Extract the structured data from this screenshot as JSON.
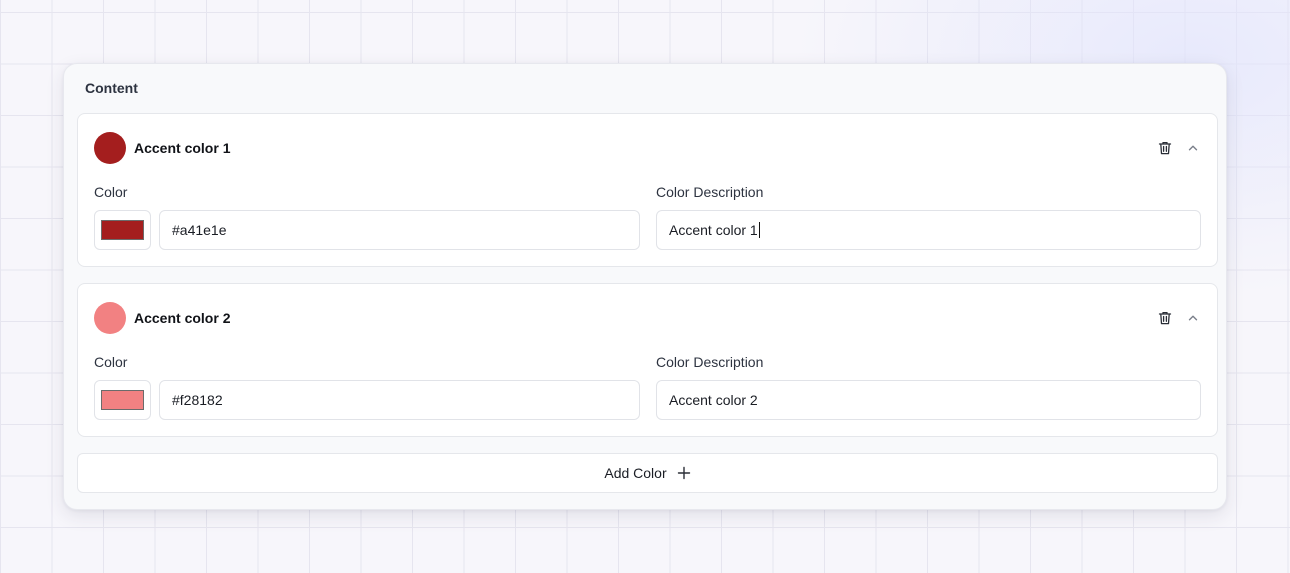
{
  "panel": {
    "title": "Content"
  },
  "colors": [
    {
      "title": "Accent color 1",
      "color_label": "Color",
      "hex": "#a41e1e",
      "description_label": "Color Description",
      "description": "Accent color 1",
      "swatch": "#a41e1e",
      "icons": {
        "delete": "trash-icon",
        "collapse": "chevron-up-icon"
      }
    },
    {
      "title": "Accent color 2",
      "color_label": "Color",
      "hex": "#f28182",
      "description_label": "Color Description",
      "description": "Accent color 2",
      "swatch": "#f28182",
      "icons": {
        "delete": "trash-icon",
        "collapse": "chevron-up-icon"
      }
    }
  ],
  "add_button": {
    "label": "Add Color",
    "icon": "plus-icon"
  }
}
